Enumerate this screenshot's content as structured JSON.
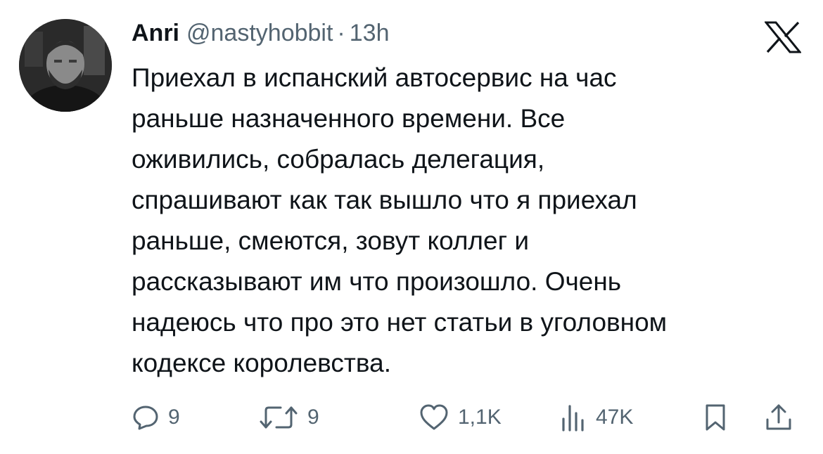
{
  "tweet": {
    "display_name": "Anri",
    "handle": "@nastyhobbit",
    "separator": "·",
    "time": "13h",
    "lines": [
      "Приехал в испанский автосервис на час",
      "раньше назначенного времени. Все",
      "оживились, собралась делегация,",
      "спрашивают как так вышло что я приехал",
      "раньше, смеются, зовут коллег и",
      "рассказывают им что произошло. Очень",
      "надеюсь что про это нет статьи в уголовном",
      "кодексе королевства."
    ]
  },
  "actions": {
    "replies": {
      "icon": "reply-icon",
      "count": "9"
    },
    "reposts": {
      "icon": "repost-icon",
      "count": "9"
    },
    "likes": {
      "icon": "heart-icon",
      "count": "1,1K"
    },
    "views": {
      "icon": "views-chart-icon",
      "count": "47K"
    },
    "bookmark": {
      "icon": "bookmark-icon"
    },
    "share": {
      "icon": "share-icon"
    }
  },
  "colors": {
    "text": "#0f1419",
    "secondary": "#536471",
    "background": "#ffffff"
  }
}
